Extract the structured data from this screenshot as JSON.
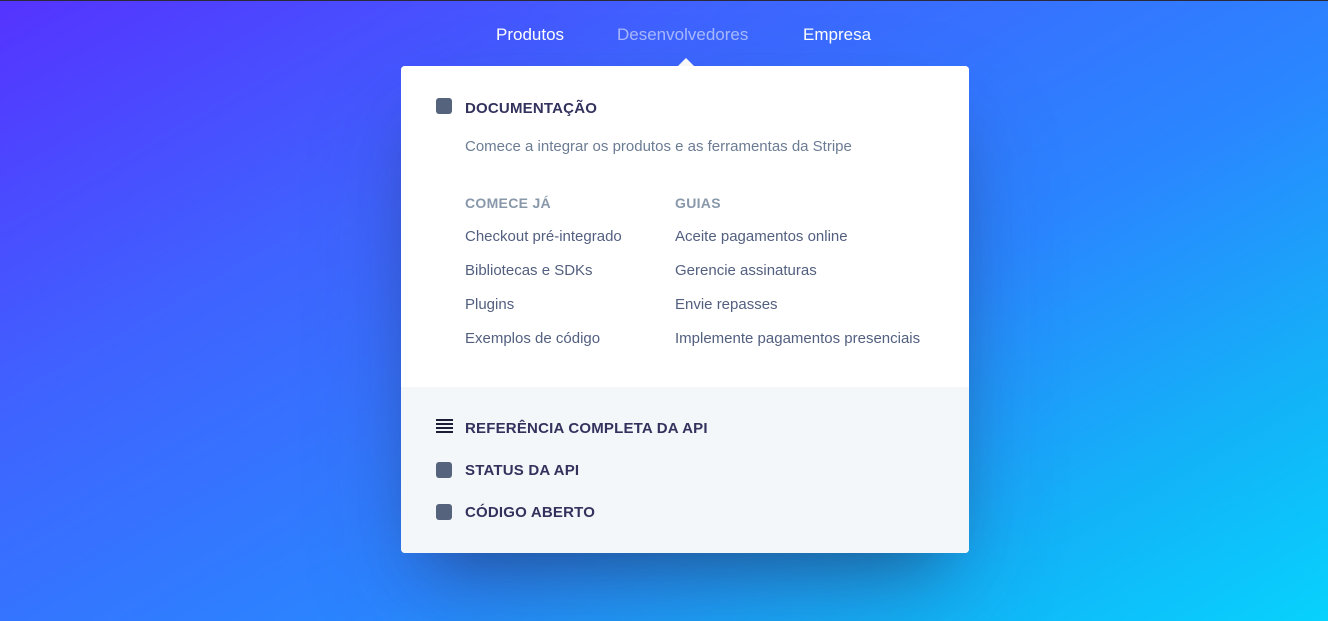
{
  "nav": {
    "items": [
      {
        "label": "Produtos"
      },
      {
        "label": "Desenvolvedores"
      },
      {
        "label": "Empresa"
      }
    ]
  },
  "dropdown": {
    "docs": {
      "title": "DOCUMENTAÇÃO",
      "description": "Comece a integrar os produtos e as ferramentas da Stripe",
      "icon": "square-icon"
    },
    "columns": [
      {
        "title": "COMECE JÁ",
        "links": [
          "Checkout pré-integrado",
          "Bibliotecas e SDKs",
          "Plugins",
          "Exemplos de código"
        ]
      },
      {
        "title": "GUIAS",
        "links": [
          "Aceite pagamentos online",
          "Gerencie assinaturas",
          "Envie repasses",
          "Implemente pagamentos presenciais"
        ]
      }
    ],
    "secondary": [
      {
        "label": "REFERÊNCIA COMPLETA DA API",
        "icon": "list-lines-icon"
      },
      {
        "label": "STATUS DA API",
        "icon": "square-icon"
      },
      {
        "label": "CÓDIGO ABERTO",
        "icon": "square-icon"
      }
    ]
  },
  "colors": {
    "gradient_start": "#5533ff",
    "gradient_end": "#07d2fd",
    "heading": "#32325d",
    "text": "#525f7f",
    "muted": "#8898aa",
    "icon": "#56637c",
    "secondary_bg": "#f4f7fa"
  }
}
